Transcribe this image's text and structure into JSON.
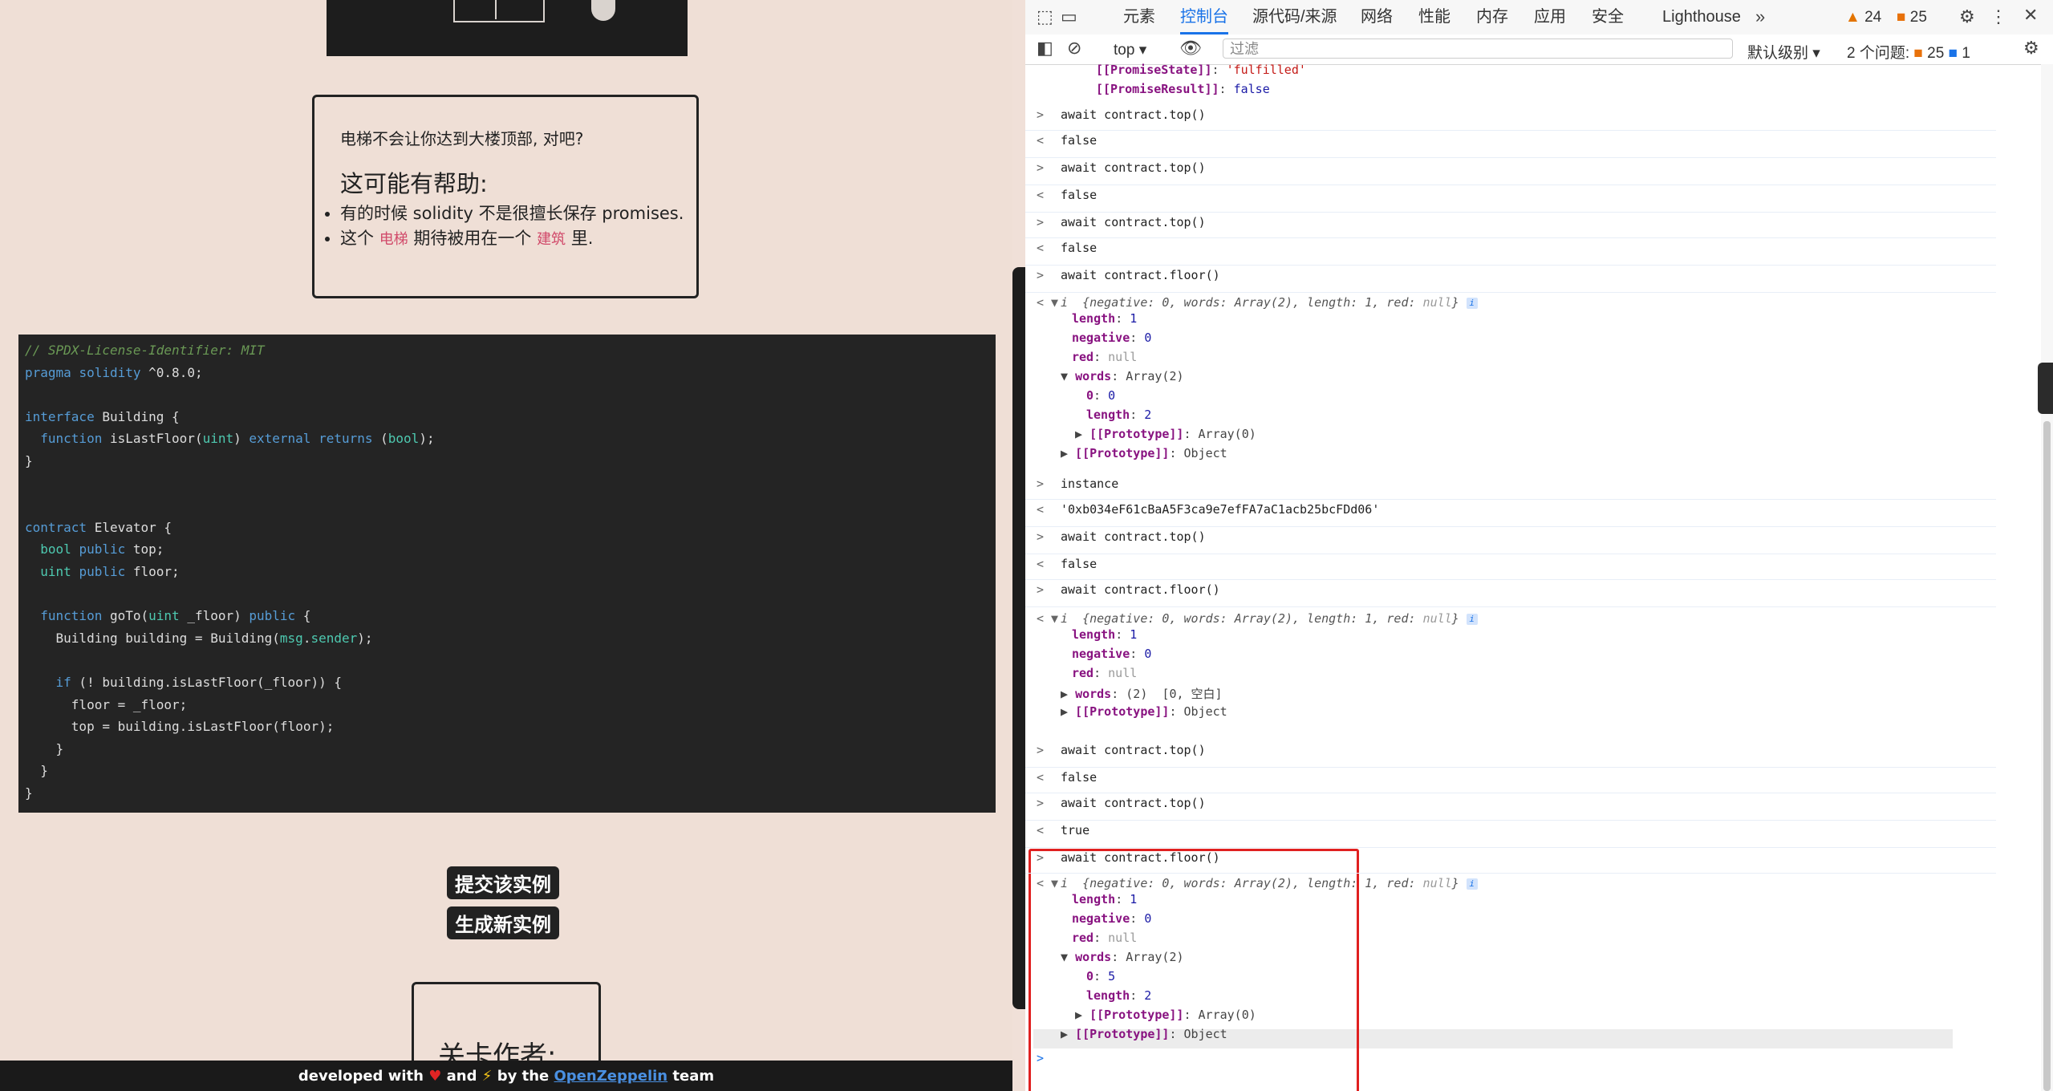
{
  "left": {
    "hint": {
      "question": "电梯不会让你达到大楼顶部, 对吧?",
      "heading": "这可能有帮助:",
      "bullet1_pre": "有的时候 solidity 不是很擅长保存 promises.",
      "bullet2_pre": "这个",
      "bullet2_kw1": "电梯",
      "bullet2_mid": "期待被用在一个",
      "bullet2_kw2": "建筑",
      "bullet2_post": "里."
    },
    "code_lines": [
      "// SPDX-License-Identifier: MIT",
      "pragma solidity ^0.8.0;",
      "",
      "interface Building {",
      "  function isLastFloor(uint) external returns (bool);",
      "}",
      "",
      "",
      "contract Elevator {",
      "  bool public top;",
      "  uint public floor;",
      "",
      "  function goTo(uint _floor) public {",
      "    Building building = Building(msg.sender);",
      "",
      "    if (! building.isLastFloor(_floor)) {",
      "      floor = _floor;",
      "      top = building.isLastFloor(floor);",
      "    }",
      "  }",
      "}"
    ],
    "submit_button": "提交该实例",
    "new_instance_button": "生成新实例",
    "author_label": "关卡作者:",
    "footer": {
      "text1": "developed with",
      "heart": "♥",
      "text2": "and",
      "bolt": "⚡",
      "text3": "by the",
      "link": "OpenZeppelin",
      "text4": "team"
    }
  },
  "devtools": {
    "tabs": [
      "元素",
      "控制台",
      "源代码/来源",
      "网络",
      "性能",
      "内存",
      "应用",
      "安全",
      "Lighthouse"
    ],
    "active_tab": "控制台",
    "warnings_count": "24",
    "errors_count": "25",
    "context": "top",
    "filter_placeholder": "过滤",
    "level": "默认级别",
    "issues_label": "2 个问题:",
    "issues_errors": "25",
    "issues_info": "1",
    "console": {
      "promise_state_key": "[[PromiseState]]",
      "promise_state_val": "'fulfilled'",
      "promise_result_key": "[[PromiseResult]]",
      "promise_result_val": "false",
      "cmd_top": "await contract.top()",
      "cmd_floor": "await contract.floor()",
      "cmd_instance": "instance",
      "false": "false",
      "true": "true",
      "address": "'0xb034eF61cBaA5F3ca9e7efFA7aC1acb25bcFDd06'",
      "obj_summary_pre": "{negative: 0, words: Array(2), length: 1, red: ",
      "null": "null",
      "obj_summary_post": "}",
      "obj_i": "i",
      "k_length": "length",
      "v_length": "1",
      "k_negative": "negative",
      "v_negative": "0",
      "k_red": "red",
      "k_words": "words",
      "v_words": "Array(2)",
      "k_0": "0",
      "v_0_first": "0",
      "v_0_last": "5",
      "v_len2": "2",
      "proto_array": "[[Prototype]]",
      "v_proto_array": "Array(0)",
      "v_proto_obj": "Object",
      "words_compact": "(2)",
      "words_compact_vals": "[0, 空白]"
    }
  }
}
